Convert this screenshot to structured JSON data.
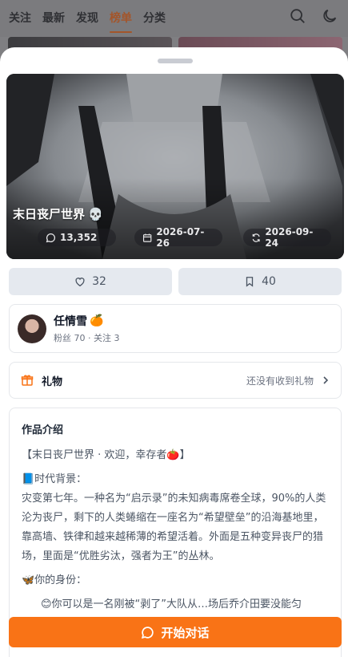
{
  "nav": {
    "tabs": [
      {
        "label": "关注"
      },
      {
        "label": "最新"
      },
      {
        "label": "发现"
      },
      {
        "label": "榜单",
        "active": true
      },
      {
        "label": "分类"
      }
    ],
    "icons": [
      "search-icon",
      "moon-icon"
    ]
  },
  "story": {
    "title": "末日丧尸世界",
    "title_emoji": "💀",
    "comments": "13,352",
    "created": "2026-07-26",
    "updated": "2026-09-24"
  },
  "actions": {
    "likes": "32",
    "bookmarks": "40"
  },
  "author": {
    "name": "任情雪",
    "name_emoji": "🍊",
    "meta": "粉丝 70 · 关注 3"
  },
  "gift": {
    "label": "礼物",
    "status": "还没有收到礼物"
  },
  "intro": {
    "heading": "作品介绍",
    "line1": "【末日丧尸世界 · 欢迎，幸存者🍅】",
    "line2": "📘时代背景：",
    "line3": "灾变第七年。一种名为“启示录”的未知病毒席卷全球，90%的人类沦为丧尸，剩下的人类蜷缩在一座名为“希望壁垒”的沿海基地里，靠高墙、铁律和越来越稀薄的希望活着。外面是五种变异丧尸的猎场，里面是“优胜劣汰，强者为王”的丛林。",
    "line4": "🦋你的身份：",
    "line5": "😊你可以是一名刚被“剥了”大队从…场后乔介田要没能匀"
  },
  "cta": {
    "label": "开始对话"
  },
  "colors": {
    "accent": "#f97316",
    "nav_active": "#a3552a"
  }
}
